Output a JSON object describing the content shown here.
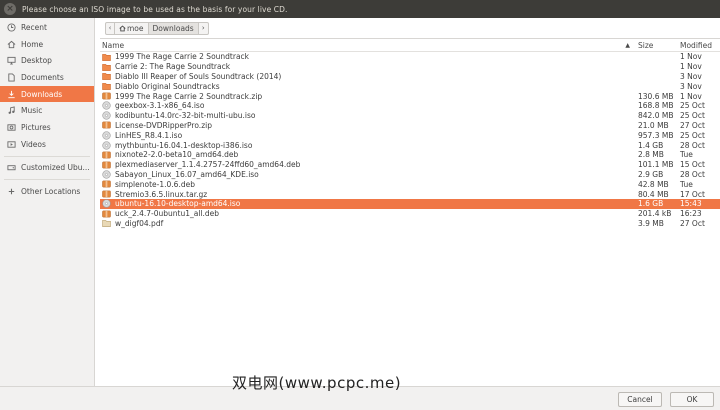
{
  "window": {
    "title": "Please choose an ISO image to be used as the basis for your live CD."
  },
  "sidebar": {
    "items": [
      {
        "label": "Recent",
        "icon": "clock-icon"
      },
      {
        "label": "Home",
        "icon": "home-icon"
      },
      {
        "label": "Desktop",
        "icon": "desktop-icon"
      },
      {
        "label": "Documents",
        "icon": "documents-icon"
      },
      {
        "label": "Downloads",
        "icon": "downloads-icon",
        "active": true
      },
      {
        "label": "Music",
        "icon": "music-icon"
      },
      {
        "label": "Pictures",
        "icon": "pictures-icon"
      },
      {
        "label": "Videos",
        "icon": "videos-icon"
      }
    ],
    "drives": [
      {
        "label": "Customized Ubu...",
        "icon": "drive-icon"
      }
    ],
    "other": {
      "label": "Other Locations",
      "icon": "plus-icon"
    }
  },
  "pathbar": {
    "home": "moe",
    "current": "Downloads"
  },
  "columns": {
    "name": "Name",
    "size": "Size",
    "modified": "Modified"
  },
  "files": [
    {
      "name": "1999 The Rage Carrie 2 Soundtrack",
      "size": "",
      "modified": "1 Nov",
      "type": "folder"
    },
    {
      "name": "Carrie 2: The Rage Soundtrack",
      "size": "",
      "modified": "1 Nov",
      "type": "folder"
    },
    {
      "name": "Diablo III Reaper of Souls Soundtrack (2014)",
      "size": "",
      "modified": "3 Nov",
      "type": "folder"
    },
    {
      "name": "Diablo Original Soundtracks",
      "size": "",
      "modified": "3 Nov",
      "type": "folder"
    },
    {
      "name": "1999 The Rage Carrie 2 Soundtrack.zip",
      "size": "130.6 MB",
      "modified": "1 Nov",
      "type": "archive"
    },
    {
      "name": "geexbox-3.1-x86_64.iso",
      "size": "168.8 MB",
      "modified": "25 Oct",
      "type": "disc"
    },
    {
      "name": "kodibuntu-14.0rc-32-bit-multi-ubu.iso",
      "size": "842.0 MB",
      "modified": "25 Oct",
      "type": "disc"
    },
    {
      "name": "License-DVDRipperPro.zip",
      "size": "21.0 MB",
      "modified": "27 Oct",
      "type": "archive"
    },
    {
      "name": "LinHES_R8.4.1.iso",
      "size": "957.3 MB",
      "modified": "25 Oct",
      "type": "disc"
    },
    {
      "name": "mythbuntu-16.04.1-desktop-i386.iso",
      "size": "1.4 GB",
      "modified": "28 Oct",
      "type": "disc"
    },
    {
      "name": "nixnote2-2.0-beta10_amd64.deb",
      "size": "2.8 MB",
      "modified": "Tue",
      "type": "archive"
    },
    {
      "name": "plexmediaserver_1.1.4.2757-24ffd60_amd64.deb",
      "size": "101.1 MB",
      "modified": "15 Oct",
      "type": "archive"
    },
    {
      "name": "Sabayon_Linux_16.07_amd64_KDE.iso",
      "size": "2.9 GB",
      "modified": "28 Oct",
      "type": "disc"
    },
    {
      "name": "simplenote-1.0.6.deb",
      "size": "42.8 MB",
      "modified": "Tue",
      "type": "archive"
    },
    {
      "name": "Stremio3.6.5.linux.tar.gz",
      "size": "80.4 MB",
      "modified": "17 Oct",
      "type": "archive"
    },
    {
      "name": "ubuntu-16.10-desktop-amd64.iso",
      "size": "1.6 GB",
      "modified": "15:43",
      "type": "disc",
      "selected": true
    },
    {
      "name": "uck_2.4.7-0ubuntu1_all.deb",
      "size": "201.4 kB",
      "modified": "16:23",
      "type": "archive"
    },
    {
      "name": "w_digf04.pdf",
      "size": "3.9 MB",
      "modified": "27 Oct",
      "type": "pdf"
    }
  ],
  "buttons": {
    "cancel": "Cancel",
    "ok": "OK"
  },
  "watermark": "双电网(www.pcpc.me)",
  "colors": {
    "accent": "#f07746",
    "titlebar": "#3d3c38",
    "sidebar": "#f2f1f0"
  }
}
